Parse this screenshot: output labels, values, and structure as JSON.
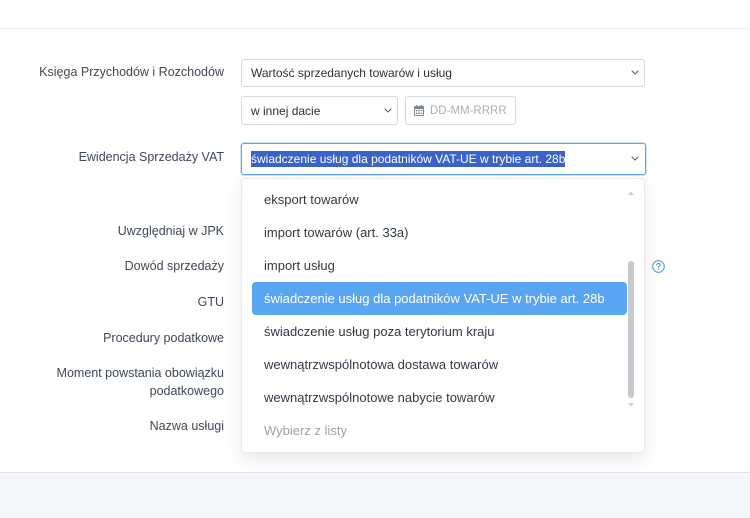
{
  "colors": {
    "focus_border": "#5da3ef",
    "option_highlight": "#5aa5f1",
    "text_selection": "#3a63c7",
    "help_icon": "#5b9bd5",
    "footer_bg": "#f5f7fa"
  },
  "icons": {
    "select_arrow": "chevron-down-icon",
    "date": "calendar-icon",
    "help": "question-circle-icon",
    "scroll_up": "scroll-up-arrow-icon",
    "scroll_down": "scroll-down-arrow-icon"
  },
  "form": {
    "ksiega": {
      "label": "Księga Przychodów i Rozchodów",
      "value_select": "Wartość sprzedanych towarów i usług",
      "date_mode_select": "w innej dacie",
      "date_input": {
        "value": "",
        "placeholder": "DD-MM-RRRR"
      }
    },
    "ewidencja": {
      "label": "Ewidencja Sprzedaży VAT",
      "value": "świadczenie usług dla podatników VAT-UE w trybie art. 28b",
      "dropdown_open": true,
      "options": [
        "eksport towarów",
        "import towarów (art. 33a)",
        "import usług",
        "świadczenie usług dla podatników VAT-UE w trybie art. 28b",
        "świadczenie usług poza terytorium kraju",
        "wewnątrzwspólnotowa dostawa towarów",
        "wewnątrzwspólnotowe nabycie towarów"
      ],
      "highlighted_index": 3,
      "empty_option": "Wybierz z listy"
    },
    "uwzgledniaj_w_jpk": {
      "label": "Uwzględniaj w JPK"
    },
    "dowod_sprzedazy": {
      "label": "Dowód sprzedaży"
    },
    "gtu": {
      "label": "GTU"
    },
    "procedury_podatkowe": {
      "label": "Procedury podatkowe"
    },
    "moment_powstania": {
      "label_lines": [
        "Moment powstania obowiązku",
        "podatkowego"
      ]
    },
    "nazwa_uslugi": {
      "label": "Nazwa usługi"
    }
  }
}
